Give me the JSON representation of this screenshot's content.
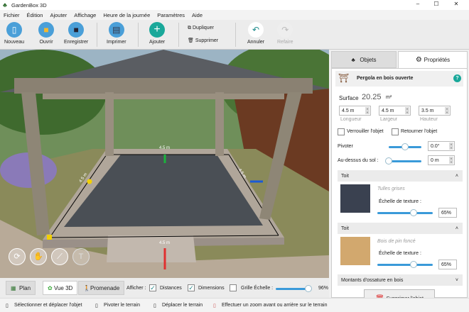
{
  "window": {
    "title": "GardenBox 3D"
  },
  "menu": [
    "Fichier",
    "Édition",
    "Ajouter",
    "Affichage",
    "Heure de la journée",
    "Paramètres",
    "Aide"
  ],
  "toolbar": {
    "new": "Nouveau",
    "open": "Ouvrir",
    "save": "Enregistrer",
    "print": "Imprimer",
    "add": "Ajouter",
    "duplicate": "Dupliquer",
    "delete": "Supprimer",
    "undo": "Annuler",
    "redo": "Refaire"
  },
  "viewport": {
    "dim_top": "4.5 m",
    "dim_left": "4.5 m",
    "dim_right": "4.5 m",
    "dim_bottom": "4.5 m"
  },
  "panel": {
    "tabs": {
      "objects": "Objets",
      "properties": "Propriétés"
    },
    "object_name": "Pergola en bois ouverte",
    "help": "?",
    "surface_label": "Surface",
    "surface_value": "20.25",
    "surface_unit": "m²",
    "length": "4.5 m",
    "width": "4.5 m",
    "height": "3.5 m",
    "length_label": "Longueur",
    "width_label": "Largeur",
    "height_label": "Hauteur",
    "lock": "Verrouiller l'objet",
    "flip": "Retourner l'objet",
    "rotate_label": "Pivoter",
    "rotate_value": "0.0°",
    "rotate_fraction": 0.5,
    "elev_label": "Au-dessus du sol :",
    "elev_value": "0 m",
    "elev_fraction": 0,
    "sections": [
      {
        "title": "Toit",
        "material": "Tulles grises",
        "scale_label": "Échelle de texture :",
        "scale": "65%",
        "scale_fraction": 0.65,
        "color": "#3a4150"
      },
      {
        "title": "Toit",
        "material": "Bois de pin foncé",
        "scale_label": "Échelle de texture :",
        "scale": "65%",
        "scale_fraction": 0.65,
        "color": "#d2a86e"
      }
    ],
    "frame_section": "Montants d'ossature en bois",
    "delete_object": "Supprimer l'objet"
  },
  "bottom": {
    "plan": "Plan",
    "view3d": "Vue 3D",
    "walk": "Promenade",
    "show": "Afficher :",
    "distances": "Distances",
    "distances_checked": true,
    "dimensions": "Dimensions",
    "dimensions_checked": true,
    "grid": "Grille Échelle :",
    "grid_checked": false,
    "scale_value": "96%",
    "scale_fraction": 0.96
  },
  "status": [
    "Sélectionner et déplacer l'objet",
    "Pivoter le terrain",
    "Déplacer le terrain",
    "Effectuer un zoom avant ou arrière sur le terrain"
  ]
}
